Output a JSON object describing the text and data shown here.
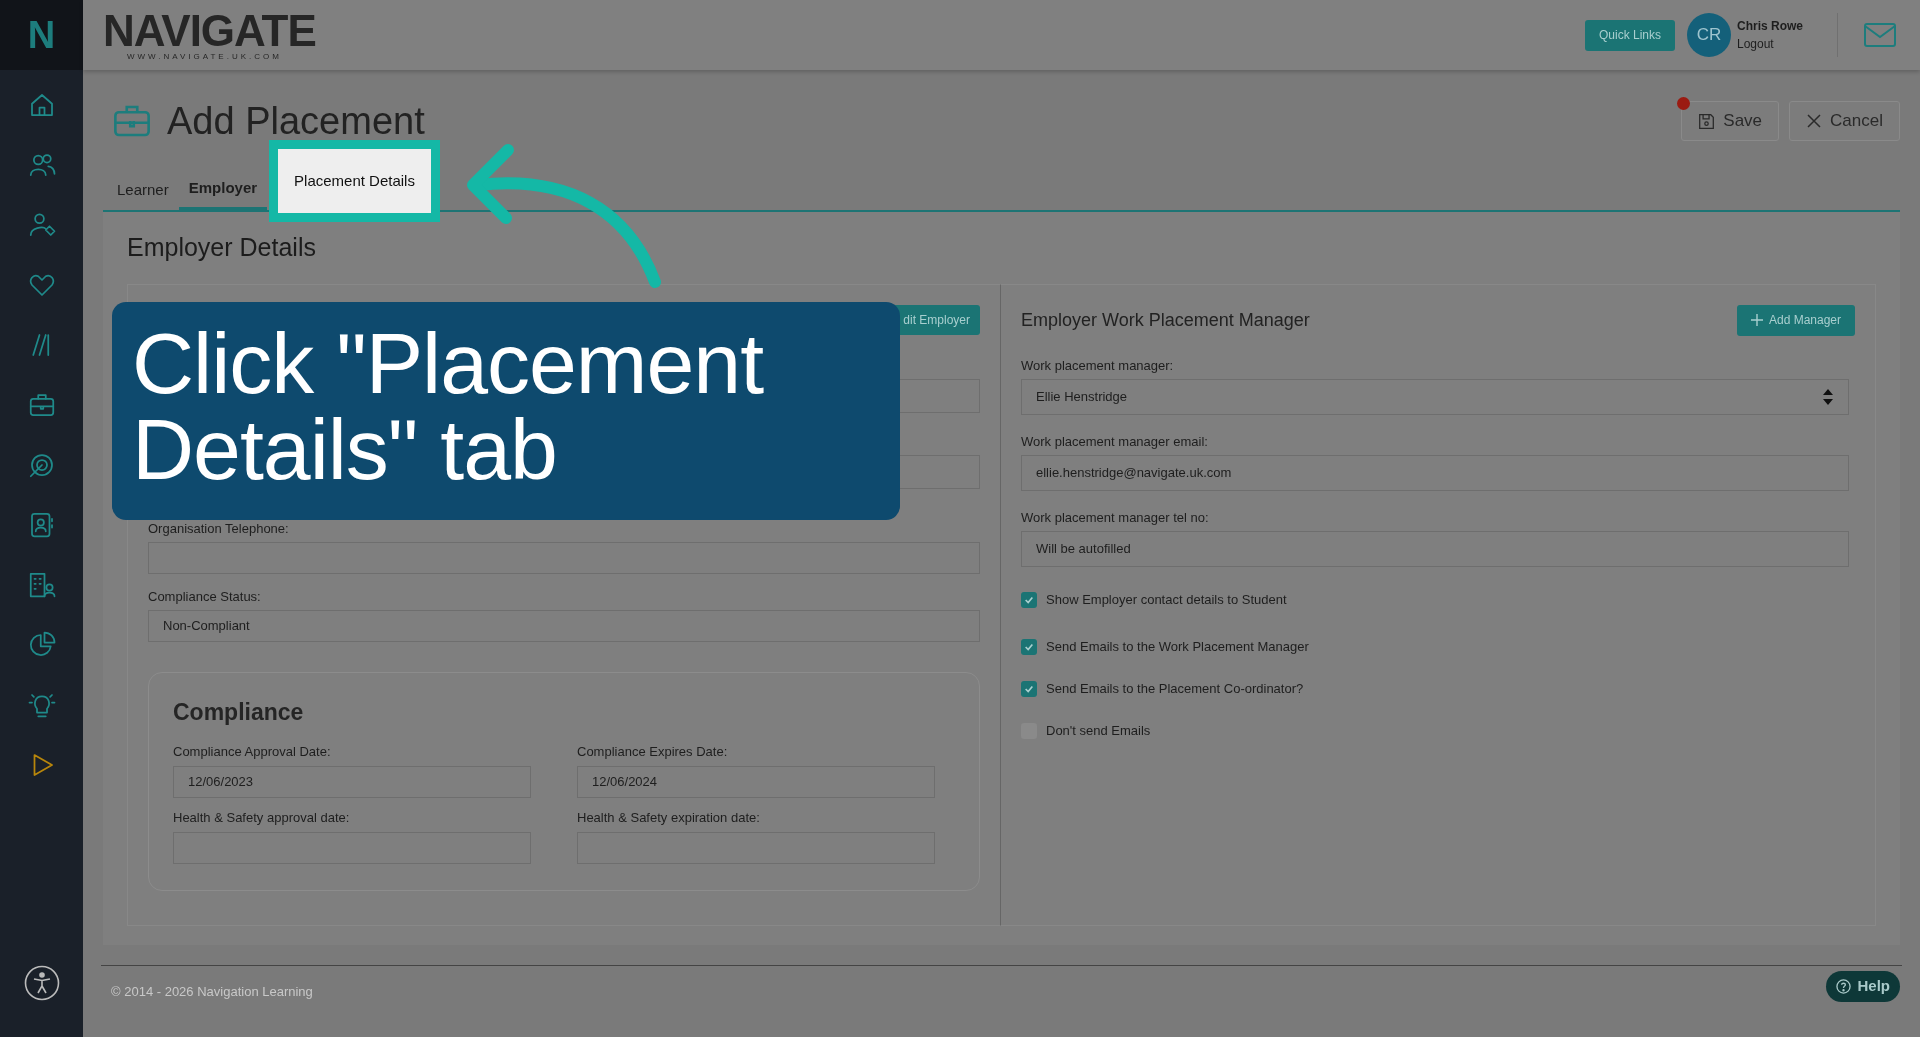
{
  "logo": {
    "name": "NAVIGATE",
    "url": "WWW.NAVIGATE.UK.COM",
    "mark": "N"
  },
  "header": {
    "quick_links": "Quick Links",
    "avatar": "CR",
    "user": "Chris Rowe",
    "logout": "Logout"
  },
  "page": {
    "title": "Add Placement",
    "save": "Save",
    "cancel": "Cancel",
    "unsaved": true
  },
  "tabs": [
    {
      "label": "Learner",
      "selected": false,
      "highlighted": false
    },
    {
      "label": "Employer",
      "selected": true,
      "highlighted": false
    },
    {
      "label": "Placement Details",
      "selected": false,
      "highlighted": true
    }
  ],
  "section_title": "Employer Details",
  "left_panel": {
    "edit_button": "dit Employer",
    "fields": [
      {
        "label": "Organisation Telephone:"
      },
      {
        "label": "Compliance Status:",
        "value": "Non-Compliant"
      }
    ],
    "compliance": {
      "title": "Compliance",
      "fields": [
        {
          "label": "Compliance Approval Date:",
          "value": "12/06/2023"
        },
        {
          "label": "Compliance Expires Date:",
          "value": "12/06/2024"
        },
        {
          "label": "Health & Safety approval date:"
        },
        {
          "label": "Health & Safety expiration date:"
        }
      ]
    }
  },
  "right_panel": {
    "title": "Employer Work Placement Manager",
    "add_button": "Add Manager",
    "fields": [
      {
        "kind": "select",
        "label": "Work placement manager:",
        "value": "Ellie Henstridge"
      },
      {
        "kind": "text",
        "label": "Work placement manager email:",
        "value": "ellie.henstridge@navigate.uk.com"
      },
      {
        "kind": "text",
        "label": "Work placement manager tel no:",
        "value": "Will be autofilled"
      }
    ],
    "checkboxes": [
      {
        "label": "Show Employer contact details to Student",
        "checked": true
      },
      {
        "label": "Send Emails to the Work Placement Manager",
        "checked": true
      },
      {
        "label": "Send Emails to the Placement Co-ordinator?",
        "checked": true
      },
      {
        "label": "Don't send Emails",
        "checked": false
      }
    ]
  },
  "callout": "Click \"Placement Details\" tab",
  "footer": {
    "copyright": "© 2014 - 2026 Navigation Learning",
    "help": "Help"
  }
}
